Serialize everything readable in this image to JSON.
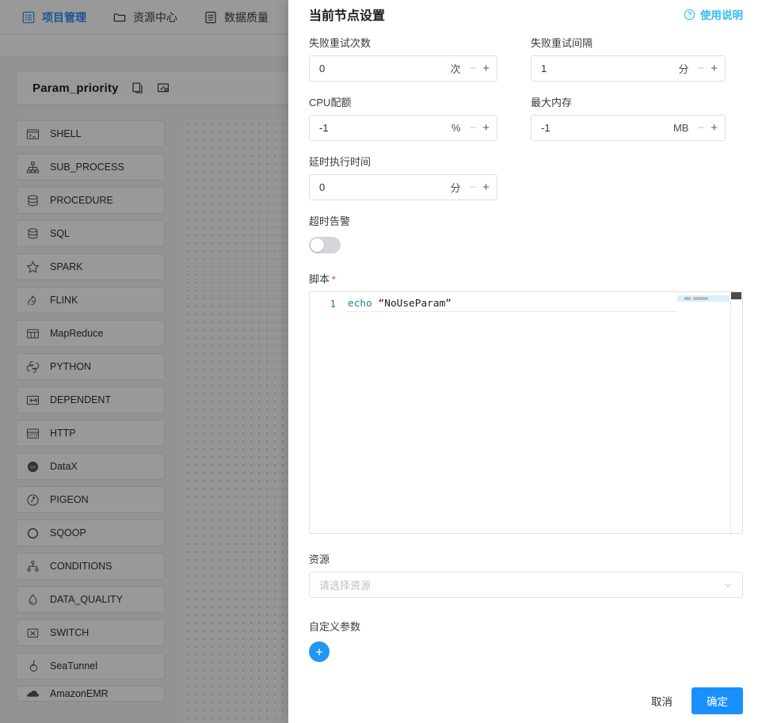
{
  "topnav": {
    "items": [
      {
        "label": "项目管理",
        "icon": "project-icon",
        "active": true
      },
      {
        "label": "资源中心",
        "icon": "folder-icon",
        "active": false
      },
      {
        "label": "数据质量",
        "icon": "quality-icon",
        "active": false
      }
    ]
  },
  "workflow": {
    "name": "Param_priority",
    "copy_icon": "copy-icon",
    "edit_icon": "edit-icon"
  },
  "task_palette": {
    "items": [
      {
        "label": "SHELL",
        "icon": "shell-icon"
      },
      {
        "label": "SUB_PROCESS",
        "icon": "subprocess-icon"
      },
      {
        "label": "PROCEDURE",
        "icon": "procedure-icon"
      },
      {
        "label": "SQL",
        "icon": "sql-icon"
      },
      {
        "label": "SPARK",
        "icon": "spark-icon"
      },
      {
        "label": "FLINK",
        "icon": "flink-icon"
      },
      {
        "label": "MapReduce",
        "icon": "mapreduce-icon"
      },
      {
        "label": "PYTHON",
        "icon": "python-icon"
      },
      {
        "label": "DEPENDENT",
        "icon": "dependent-icon"
      },
      {
        "label": "HTTP",
        "icon": "http-icon"
      },
      {
        "label": "DataX",
        "icon": "datax-icon"
      },
      {
        "label": "PIGEON",
        "icon": "pigeon-icon"
      },
      {
        "label": "SQOOP",
        "icon": "sqoop-icon"
      },
      {
        "label": "CONDITIONS",
        "icon": "conditions-icon"
      },
      {
        "label": "DATA_QUALITY",
        "icon": "dataquality-icon"
      },
      {
        "label": "SWITCH",
        "icon": "switch-icon"
      },
      {
        "label": "SeaTunnel",
        "icon": "seatunnel-icon"
      },
      {
        "label": "AmazonEMR",
        "icon": "amazonemr-icon"
      }
    ]
  },
  "dialog": {
    "title": "当前节点设置",
    "help_label": "使用说明",
    "help_icon": "question-circle-icon",
    "fields": {
      "retry_times": {
        "label": "失败重试次数",
        "value": "0",
        "unit": "次"
      },
      "retry_interval": {
        "label": "失败重试间隔",
        "value": "1",
        "unit": "分"
      },
      "cpu_quota": {
        "label": "CPU配额",
        "value": "-1",
        "unit": "%"
      },
      "max_memory": {
        "label": "最大内存",
        "value": "-1",
        "unit": "MB"
      },
      "delay_time": {
        "label": "延时执行时间",
        "value": "0",
        "unit": "分"
      },
      "timeout_alarm": {
        "label": "超时告警",
        "enabled": false
      },
      "script": {
        "label": "脚本",
        "required_mark": "*",
        "line_number": "1",
        "keyword": "echo",
        "string": " “NoUseParam”"
      },
      "resource": {
        "label": "资源",
        "placeholder": "请选择资源",
        "chevron_icon": "chevron-down-icon"
      },
      "custom_params": {
        "label": "自定义参数",
        "add_icon": "plus-icon"
      }
    },
    "footer": {
      "cancel": "取消",
      "confirm": "确定"
    }
  },
  "stepper": {
    "minus": "−",
    "plus": "+"
  },
  "colors": {
    "primary": "#1890ff",
    "link": "#35baf6",
    "nav_active": "#2d8cf0",
    "required": "#f5222d"
  }
}
